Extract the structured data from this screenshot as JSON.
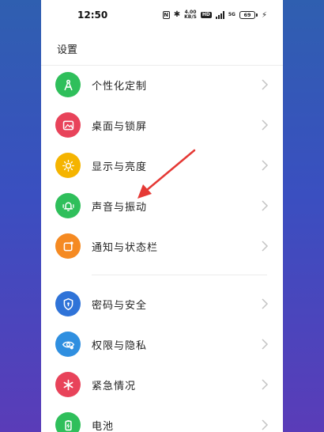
{
  "status_bar": {
    "time": "12:50",
    "nfc": "N",
    "bluetooth": "✱",
    "speed_value": "4.00",
    "speed_unit": "KB/S",
    "hd": "HD",
    "network": "5G",
    "battery": "69",
    "charging": "⚡"
  },
  "header": {
    "title": "设置"
  },
  "settings": {
    "items": [
      {
        "label": "个性化定制",
        "icon": "personalize-icon",
        "color": "#2fbf5b"
      },
      {
        "label": "桌面与锁屏",
        "icon": "wallpaper-icon",
        "color": "#e8435a"
      },
      {
        "label": "显示与亮度",
        "icon": "brightness-icon",
        "color": "#f5b400"
      },
      {
        "label": "声音与振动",
        "icon": "bell-icon",
        "color": "#2fbf5b"
      },
      {
        "label": "通知与状态栏",
        "icon": "notification-icon",
        "color": "#f58a22"
      },
      {
        "label": "密码与安全",
        "icon": "shield-icon",
        "color": "#2f73d8"
      },
      {
        "label": "权限与隐私",
        "icon": "privacy-eye-icon",
        "color": "#2f8fe0"
      },
      {
        "label": "紧急情况",
        "icon": "emergency-icon",
        "color": "#e8435a"
      },
      {
        "label": "电池",
        "icon": "battery-icon",
        "color": "#2fbf5b"
      }
    ]
  },
  "annotation": {
    "color": "#e53935",
    "icon": "red-arrow-annotation"
  }
}
